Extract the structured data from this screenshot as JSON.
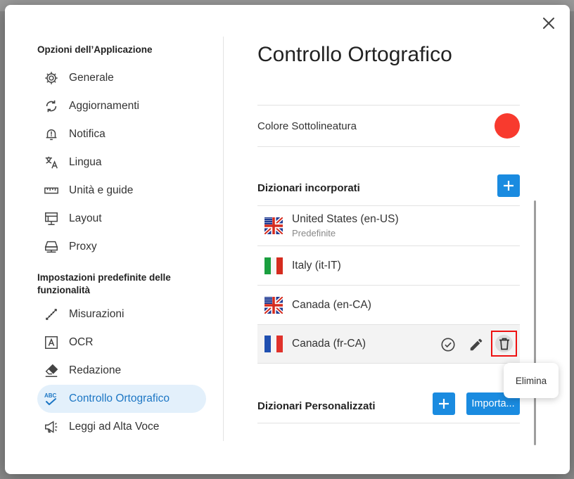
{
  "sidebar": {
    "section1_title": "Opzioni dell’Applicazione",
    "section2_title": "Impostazioni predefinite delle funzionalità",
    "items": [
      {
        "label": "Generale",
        "icon": "gear-icon"
      },
      {
        "label": "Aggiornamenti",
        "icon": "refresh-icon"
      },
      {
        "label": "Notifica",
        "icon": "bell-alert-icon"
      },
      {
        "label": "Lingua",
        "icon": "translate-icon"
      },
      {
        "label": "Unità e guide",
        "icon": "ruler-icon"
      },
      {
        "label": "Layout",
        "icon": "layout-icon"
      },
      {
        "label": "Proxy",
        "icon": "proxy-icon"
      },
      {
        "label": "Misurazioni",
        "icon": "measure-icon"
      },
      {
        "label": "OCR",
        "icon": "ocr-icon"
      },
      {
        "label": "Redazione",
        "icon": "eraser-icon"
      },
      {
        "label": "Controllo Ortografico",
        "icon": "spellcheck-icon"
      },
      {
        "label": "Leggi ad Alta Voce",
        "icon": "megaphone-icon"
      }
    ],
    "active_item": "Controllo Ortografico"
  },
  "main": {
    "title": "Controllo Ortografico",
    "underline_color_label": "Colore Sottolineatura",
    "underline_color": "#f83a2e",
    "builtin_title": "Dizionari incorporati",
    "dictionaries": [
      {
        "name": "United States (en-US)",
        "subtitle": "Predefinite",
        "flag": "uk-us"
      },
      {
        "name": "Italy (it-IT)",
        "subtitle": "",
        "flag": "italy"
      },
      {
        "name": "Canada (en-CA)",
        "subtitle": "",
        "flag": "uk-us"
      },
      {
        "name": "Canada (fr-CA)",
        "subtitle": "",
        "flag": "france"
      }
    ],
    "custom_title": "Dizionari Personalizzati",
    "import_label": "Importa..."
  },
  "tooltip": {
    "text": "Elimina"
  },
  "colors": {
    "accent": "#1a8be0",
    "active_bg": "#e3f0fb",
    "active_text": "#1c76c4",
    "delete_highlight": "#e11111"
  }
}
